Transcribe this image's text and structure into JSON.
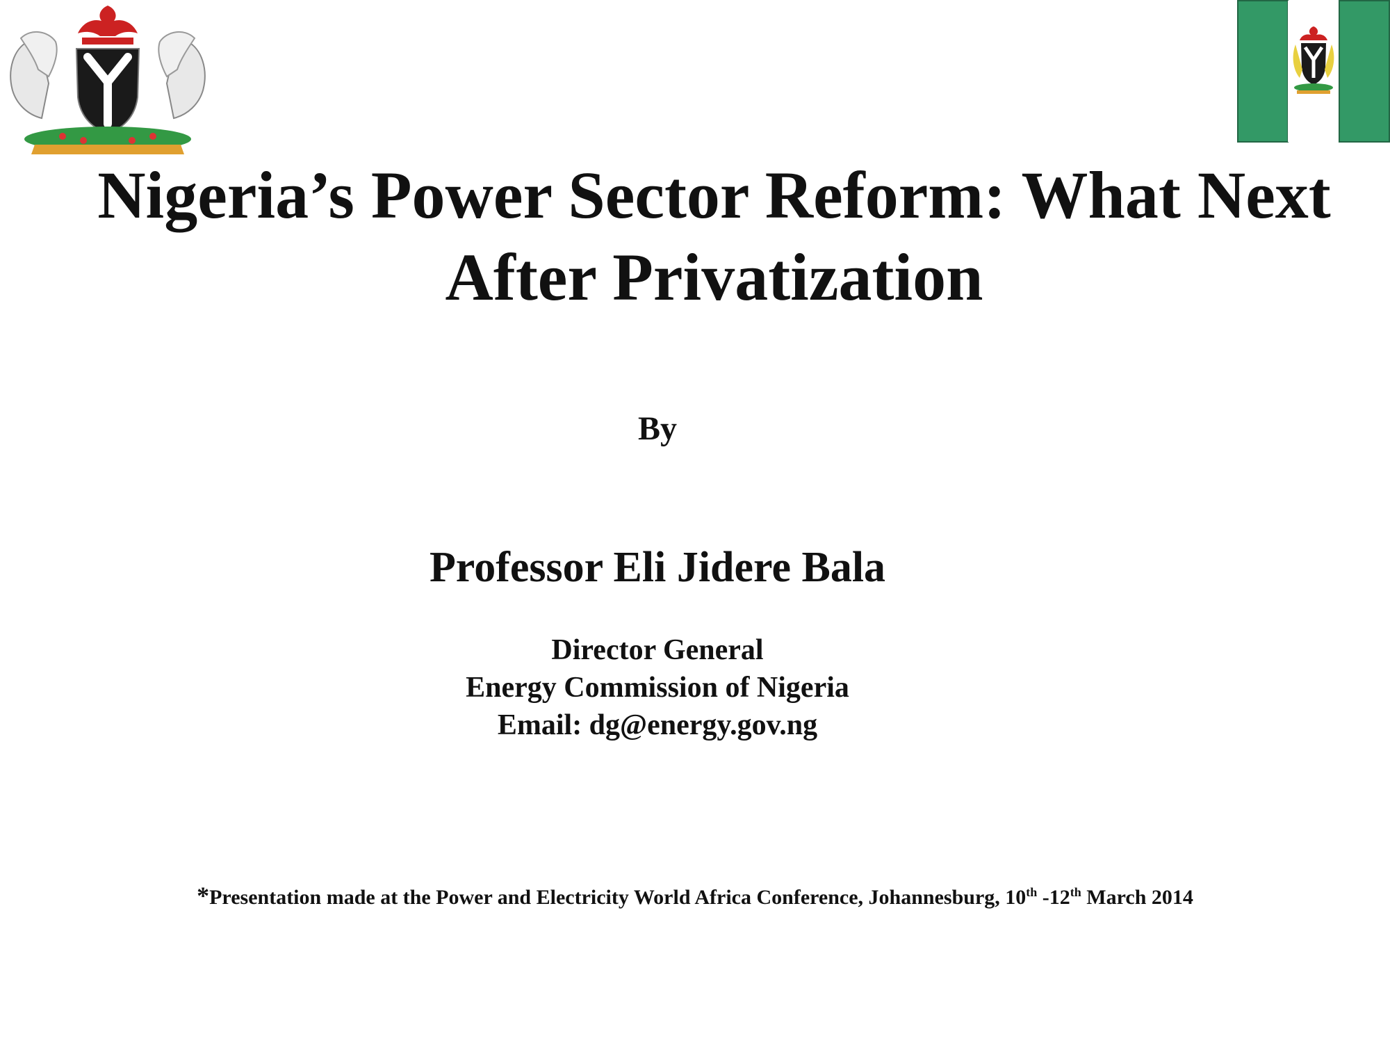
{
  "slide": {
    "title_line1": "Nigeria’s Power Sector Reform: What Next",
    "title_line2": "After Privatization",
    "by_label": "By",
    "presenter_name": "Professor Eli Jidere Bala",
    "affiliation": {
      "position": "Director General",
      "organization": "Energy Commission of Nigeria",
      "email": "Email: dg@energy.gov.ng"
    },
    "footnote": {
      "marker": "*",
      "text_before_dates": "Presentation made at the Power and  Electricity World Africa Conference, Johannesburg,  10",
      "sup1": "th",
      "dash": " -12",
      "sup2": "th",
      "text_after_dates": " March 2014"
    }
  },
  "logos": {
    "coat_of_arms_icon": "nigeria-coat-of-arms",
    "flag_icon": "nigeria-flag-with-coat-of-arms"
  },
  "colors": {
    "flag_green": "#339966",
    "eagle_red": "#cc2222",
    "shield_black": "#1a1a1a"
  }
}
